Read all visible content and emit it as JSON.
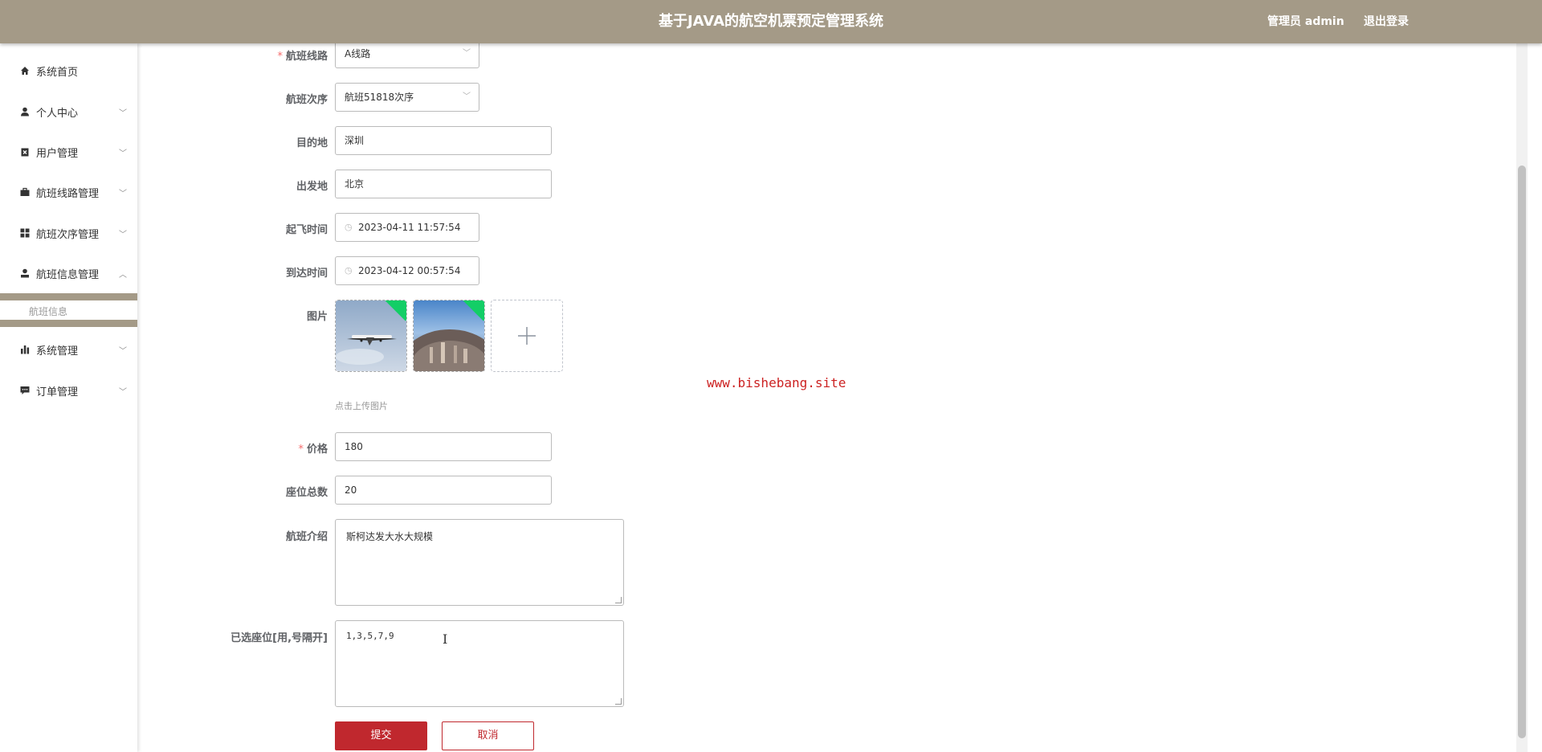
{
  "header": {
    "title": "基于JAVA的航空机票预定管理系统",
    "user": "管理员 admin",
    "logout": "退出登录"
  },
  "sidebar": {
    "items": [
      {
        "label": "系统首页",
        "icon": "home-icon"
      },
      {
        "label": "个人中心",
        "icon": "person-icon"
      },
      {
        "label": "用户管理",
        "icon": "user-manage-icon"
      },
      {
        "label": "航班线路管理",
        "icon": "briefcase-icon"
      },
      {
        "label": "航班次序管理",
        "icon": "grid-icon"
      },
      {
        "label": "航班信息管理",
        "icon": "user-info-icon"
      },
      {
        "label": "系统管理",
        "icon": "bar-chart-icon"
      },
      {
        "label": "订单管理",
        "icon": "chat-icon"
      }
    ],
    "submenu": {
      "label": "航班信息"
    }
  },
  "form": {
    "route": {
      "label": "航班线路",
      "value": "A线路"
    },
    "sequence": {
      "label": "航班次序",
      "value": "航班51818次序"
    },
    "destination": {
      "label": "目的地",
      "value": "深圳"
    },
    "origin": {
      "label": "出发地",
      "value": "北京"
    },
    "departure": {
      "label": "起飞时间",
      "value": "2023-04-11 11:57:54"
    },
    "arrival": {
      "label": "到达时间",
      "value": "2023-04-12 00:57:54"
    },
    "image": {
      "label": "图片",
      "hint": "点击上传图片"
    },
    "price": {
      "label": "价格",
      "value": "180"
    },
    "seats": {
      "label": "座位总数",
      "value": "20"
    },
    "intro": {
      "label": "航班介绍",
      "value": "斯柯达发大水大规模"
    },
    "selected": {
      "label": "已选座位[用,号隔开]",
      "value": "1,3,5,7,9"
    },
    "submit": "提交",
    "cancel": "取消"
  },
  "watermark": "www.bishebang.site"
}
